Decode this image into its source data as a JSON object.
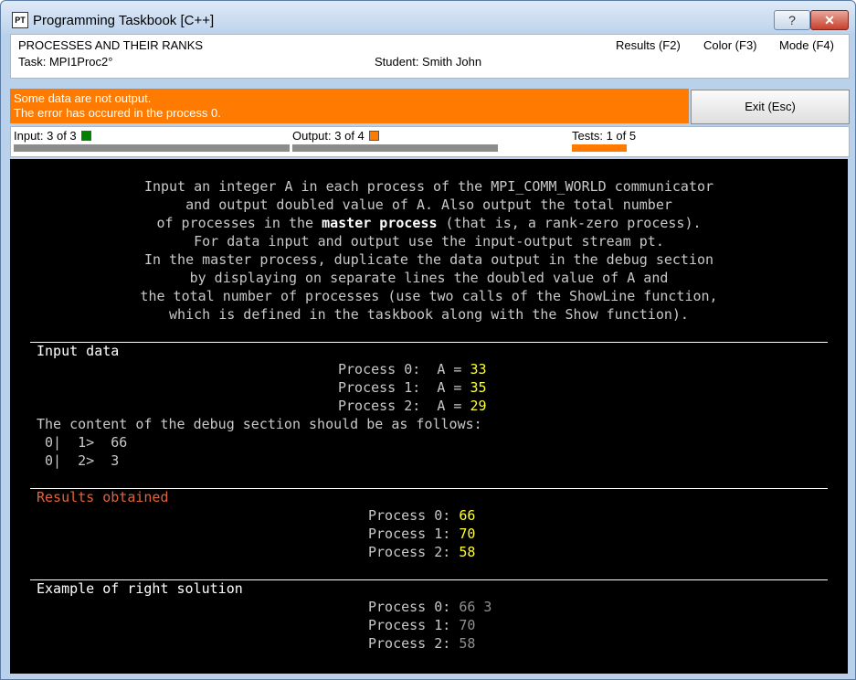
{
  "window": {
    "title": "Programming Taskbook [C++]",
    "icon_text": "PT",
    "help_label": "?",
    "close_label": "✕"
  },
  "header": {
    "section": "PROCESSES AND THEIR RANKS",
    "task": "Task: MPI1Proc2°",
    "student": "Student: Smith John",
    "menu": {
      "results": "Results (F2)",
      "color": "Color (F3)",
      "mode": "Mode (F4)"
    }
  },
  "error": {
    "line1": "Some data are not output.",
    "line2": "The error has occured in the process 0.",
    "color": "#ff7a00"
  },
  "exit_label": "Exit (Esc)",
  "status": {
    "input_label": "Input: 3 of 3",
    "output_label": "Output: 3 of 4",
    "tests_label": "Tests: 1 of 5",
    "input_color": "#008000",
    "output_color": "#ff7a00"
  },
  "description": {
    "l1": "Input an integer A in each process of the MPI_COMM_WORLD communicator",
    "l2": "and output doubled value of A. Also output the total number",
    "l3a": "of processes in the ",
    "l3b": "master process",
    "l3c": " (that is, a rank-zero process).",
    "l4": "For data input and output use the input-output stream pt.",
    "l5": "In the master process, duplicate the data output in the debug section",
    "l6": "by displaying on separate lines the doubled value of A and",
    "l7": "the total number of processes (use two calls of the ShowLine function,",
    "l8": "which is defined in the taskbook along with the Show function)."
  },
  "input_data": {
    "heading": "Input data",
    "rows": [
      {
        "label": "Process 0:  A = ",
        "value": "33"
      },
      {
        "label": "Process 1:  A = ",
        "value": "35"
      },
      {
        "label": "Process 2:  A = ",
        "value": "29"
      }
    ],
    "debug_heading": "The content of the debug section should be as follows:",
    "debug": [
      " 0|  1>  66",
      " 0|  2>  3"
    ]
  },
  "results": {
    "heading": "Results obtained",
    "rows": [
      {
        "label": "Process 0: ",
        "value": "66"
      },
      {
        "label": "Process 1: ",
        "value": "70"
      },
      {
        "label": "Process 2: ",
        "value": "58"
      }
    ]
  },
  "example": {
    "heading": "Example of right solution",
    "rows": [
      {
        "label": "Process 0: ",
        "value": "66 3"
      },
      {
        "label": "Process 1: ",
        "value": "70"
      },
      {
        "label": "Process 2: ",
        "value": "58"
      }
    ]
  }
}
